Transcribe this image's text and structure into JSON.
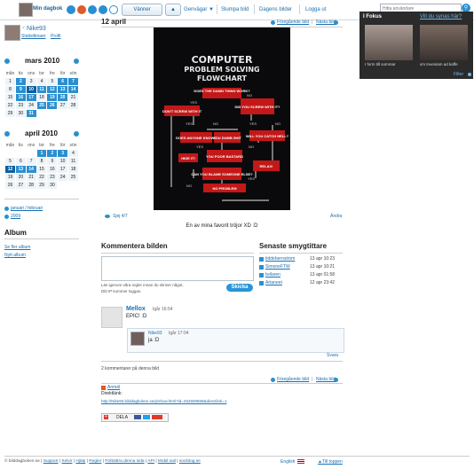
{
  "topbar": {
    "my_diary": "Min dagbok",
    "friends_button": "Vänner",
    "shortcuts": "Genvägar",
    "random_image": "Slumpa bild",
    "todays_images": "Dagens bilder",
    "logout": "Logga ut",
    "search_placeholder": "Hitta användare"
  },
  "profile": {
    "username": "Nike93",
    "statistics": "Statistiknaer",
    "profile_link": "Profil"
  },
  "calendars": [
    {
      "title": "mars 2010",
      "weekdays": [
        "mån",
        "tis",
        "ons",
        "tor",
        "fre",
        "lör",
        "sön"
      ],
      "weeks": [
        [
          "1",
          "2",
          "3",
          "4",
          "5",
          "6",
          "7"
        ],
        [
          "8",
          "9",
          "10",
          "11",
          "12",
          "13",
          "14"
        ],
        [
          "15",
          "16",
          "17",
          "18",
          "19",
          "20",
          "21"
        ],
        [
          "22",
          "23",
          "24",
          "25",
          "26",
          "27",
          "28"
        ],
        [
          "29",
          "30",
          "31",
          "",
          "",
          "",
          ""
        ]
      ]
    },
    {
      "title": "april 2010",
      "weekdays": [
        "mån",
        "tis",
        "ons",
        "tor",
        "fre",
        "lör",
        "sön"
      ],
      "weeks": [
        [
          "",
          "",
          "",
          "1",
          "2",
          "3",
          "4"
        ],
        [
          "5",
          "6",
          "7",
          "8",
          "9",
          "10",
          "11"
        ],
        [
          "12",
          "13",
          "14",
          "15",
          "16",
          "17",
          "18"
        ],
        [
          "19",
          "20",
          "21",
          "22",
          "23",
          "24",
          "25"
        ],
        [
          "26",
          "27",
          "28",
          "29",
          "30",
          "",
          ""
        ]
      ]
    }
  ],
  "archive": {
    "months_link": "januari / februari",
    "year_link": "2009"
  },
  "album": {
    "title": "Album",
    "see_more": "Se fler album",
    "new_album": "Nytt album"
  },
  "post": {
    "date": "12 april",
    "prev": "Föregående bild",
    "next": "Nästa bild",
    "seen": "Sjej 4/7",
    "edit": "Ändra",
    "caption": "En av mina favorit tröjor XD :D",
    "image_lines": [
      "COMPUTER",
      "PROBLEM SOLVING",
      "FLOWCHART"
    ],
    "image_labels": [
      "DOES THE DAMN THING WORK?",
      "DON'T SCREW WITH IT",
      "DID YOU SCREW WITH IT?",
      "DOES ANYONE KNOW?",
      "YOU DUMB SHIT",
      "WILL YOU CATCH HELL?",
      "HIDE IT!",
      "YOU POOR BASTARD",
      "RELAX!",
      "CAN YOU BLAME SOMEONE ELSE?",
      "NO PROBLEM"
    ],
    "image_yes_no": [
      "YES",
      "NO",
      "YES",
      "NO",
      "YES",
      "NO",
      "YES",
      "NO",
      "YES",
      "NO"
    ]
  },
  "comment_section": {
    "title": "Kommentera bilden",
    "terms_text": "Läs igenom våra regler innan du skriver något.",
    "ip_text": "Ditt IP kommer loggas.",
    "send_button": "Skicka"
  },
  "comments": [
    {
      "author": "Mellox",
      "time": "Igår 16:54",
      "text": "EPIC! :D"
    }
  ],
  "reply": {
    "author": "Nike93",
    "time": "Igår 17:04",
    "text": "ja :D",
    "reply_link": "Svara"
  },
  "comment_count": "2 kommentarer på denna bild",
  "report": "Anmäl",
  "direct_link_label": "Direktlänk:",
  "direct_link_url": "http://Nike93.bilddagboken.se/p/show.html?id=452600658&directlink=1",
  "share_label": "DELA",
  "visitors": {
    "title": "Senaste smygtittare",
    "list": [
      {
        "name": "tiddebernstrom",
        "time": "13 apr 10:23"
      },
      {
        "name": "SimoneFTW",
        "time": "13 apr 10:21"
      },
      {
        "name": "lwilaren",
        "time": "13 apr 01:58"
      },
      {
        "name": "Artaneet",
        "time": "12 apr 23:42"
      }
    ]
  },
  "focus": {
    "title": "I Fokus",
    "question": "Vill du synas här?",
    "caption_left": "I form till sommar",
    "caption_right": "vm Inveniam ad kaffe",
    "filter": "Filter"
  },
  "footer": {
    "copyright": "© bilddagboken.se",
    "links": [
      "Support",
      "Kelvir",
      "Hjälp",
      "Regler",
      "Förbättra denna sida",
      "API",
      "Mobil sail",
      "sociblog.se"
    ],
    "language": "English",
    "to_top": "Till toppen"
  },
  "colors": {
    "accent": "#2a8fd0",
    "accent_dark": "#0d5fa0",
    "link": "#1a6fb0",
    "send_button": "#2a95d6"
  }
}
